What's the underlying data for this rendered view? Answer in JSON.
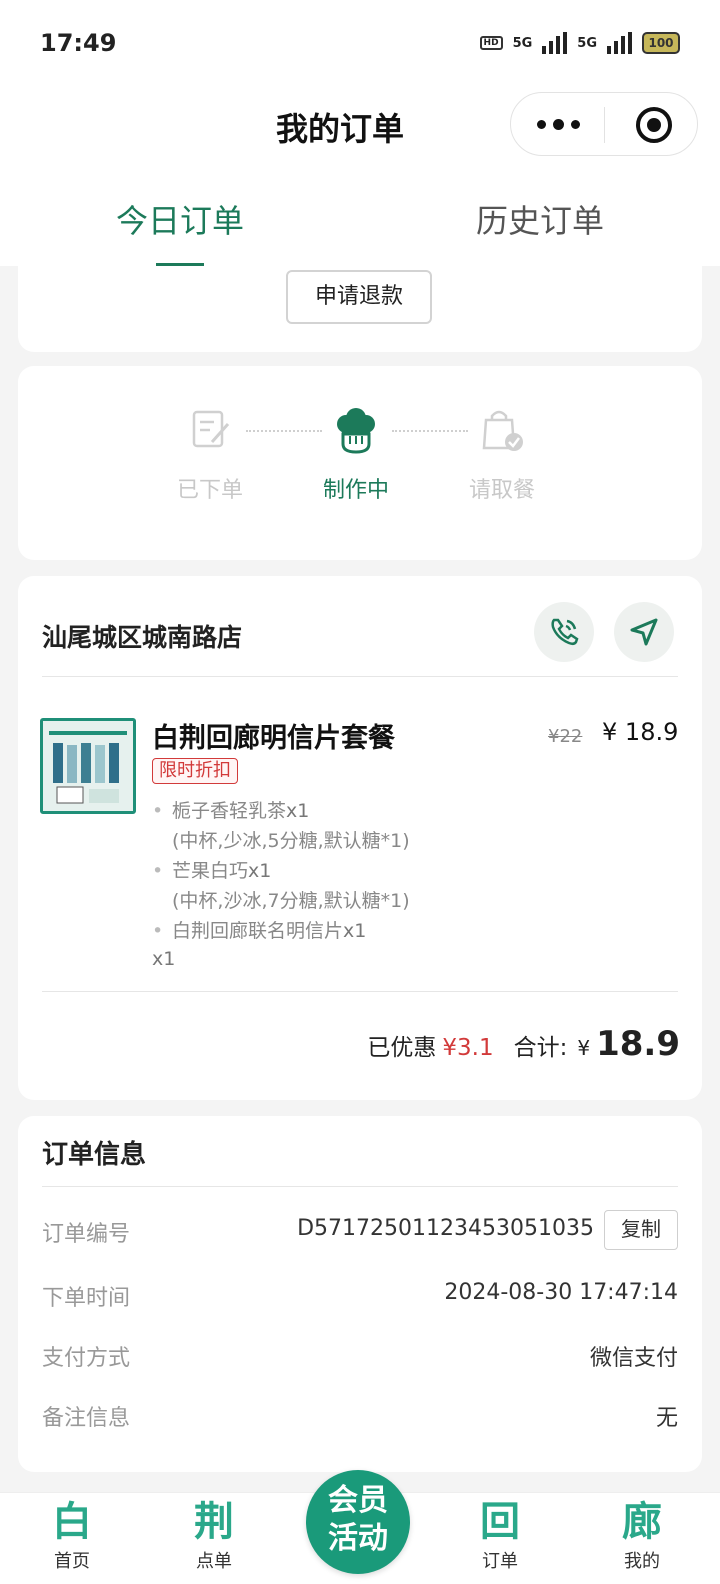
{
  "status_bar": {
    "time": "17:49",
    "network1": "5G",
    "network2": "5G",
    "battery": "100"
  },
  "nav": {
    "title": "我的订单"
  },
  "tabs": [
    {
      "label": "今日订单",
      "active": true
    },
    {
      "label": "历史订单",
      "active": false
    }
  ],
  "refund": {
    "button_label": "申请退款"
  },
  "progress": {
    "steps": [
      {
        "label": "已下单",
        "state": "done"
      },
      {
        "label": "制作中",
        "state": "current"
      },
      {
        "label": "请取餐",
        "state": "pending"
      }
    ]
  },
  "store": {
    "name": "汕尾城区城南路店",
    "product": {
      "name": "白荆回廊明信片套餐",
      "tag": "限时折扣",
      "price_old": "¥22",
      "price_symbol": "¥",
      "price_new": "18.9",
      "items": [
        {
          "name": "栀子香轻乳茶",
          "qty": "x1",
          "spec": "(中杯,少冰,5分糖,默认糖*1)"
        },
        {
          "name": "芒果白巧",
          "qty": "x1",
          "spec": "(中杯,沙冰,7分糖,默认糖*1)"
        },
        {
          "name": "白荆回廊联名明信片",
          "qty": "x1",
          "spec": ""
        }
      ],
      "total_qty": "x1"
    },
    "summary": {
      "discount_label": "已优惠",
      "discount_value": "¥3.1",
      "total_label": "合计:",
      "total_symbol": "¥",
      "total_value": "18.9"
    }
  },
  "order_info": {
    "title": "订单信息",
    "order_no_label": "订单编号",
    "order_no": "D57172501123453051035",
    "copy_label": "复制",
    "time_label": "下单时间",
    "time_value": "2024-08-30 17:47:14",
    "pay_label": "支付方式",
    "pay_value": "微信支付",
    "note_label": "备注信息",
    "note_value": "无"
  },
  "bottom_nav": {
    "items": [
      {
        "glyph": "白",
        "label": "首页"
      },
      {
        "glyph": "荆",
        "label": "点单"
      },
      {
        "glyph": "回",
        "label": "订单"
      },
      {
        "glyph": "廊",
        "label": "我的"
      }
    ],
    "member_line1": "会员",
    "member_line2": "活动"
  },
  "colors": {
    "accent": "#1c7a5a",
    "discount": "#d23a3a",
    "member": "#1a9a7a"
  }
}
